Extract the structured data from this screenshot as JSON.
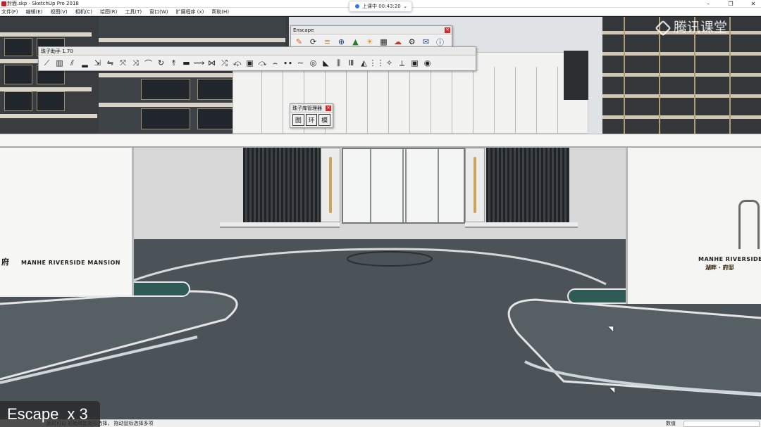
{
  "window": {
    "title": "封面.skp - SketchUp Pro 2018",
    "controls": [
      "–",
      "❐",
      "✕"
    ]
  },
  "menu": [
    "文件(F)",
    "编辑(E)",
    "视图(V)",
    "相机(C)",
    "绘图(R)",
    "工具(T)",
    "窗口(W)",
    "扩展程序 (x)",
    "帮助(H)"
  ],
  "timer": {
    "label": "上课中 00:43:20"
  },
  "watermark": {
    "text": "腾讯课堂"
  },
  "toolbars": {
    "escape": {
      "title": "Enscape",
      "tools": [
        "enscape-logo-icon",
        "refresh-icon",
        "sync-views-icon",
        "add-view-icon",
        "tree-icon",
        "sun-icon",
        "checker-icon",
        "cloud-upload-icon",
        "settings-gears-icon",
        "mail-icon",
        "info-icon"
      ],
      "glyphs": [
        "✎",
        "⟳",
        "≡",
        "⊕",
        "▲",
        "☀",
        "▦",
        "☁",
        "⚙",
        "✉",
        "ⓘ"
      ]
    },
    "zhuzi": {
      "title": "珠子助手 1.70",
      "glyphs": [
        "⟋",
        "▥",
        "⫽",
        "▂",
        "⇲",
        "⇋",
        "⤧",
        "⤨",
        "⌒",
        "↻",
        "⥉",
        "▬",
        "⟿",
        "⋈",
        "⤮",
        "⤽",
        "▣",
        "⤼",
        "⌢",
        "∙∙",
        "∼",
        "◎",
        "◣",
        "⫼",
        "Ⅲ",
        "◭",
        "⋮⋮",
        "✧",
        "⟂",
        "▣",
        "◉"
      ]
    },
    "library": {
      "title": "珠子库管理器",
      "buttons": [
        "图",
        "环",
        "模"
      ]
    }
  },
  "scene": {
    "left_sign": "MANHE RIVERSIDE MANSION",
    "left_sign_chinese": "府",
    "right_sign": "MANHE RIVERSIDE",
    "right_sign_chinese": "湖畔 · 府邸"
  },
  "overlay": {
    "key": "Escape",
    "count": "x 3"
  },
  "status": {
    "hint": "此时可以 初始绑定矩形选择， 拖动鼠标选择多项",
    "measurements_label": "数值"
  }
}
